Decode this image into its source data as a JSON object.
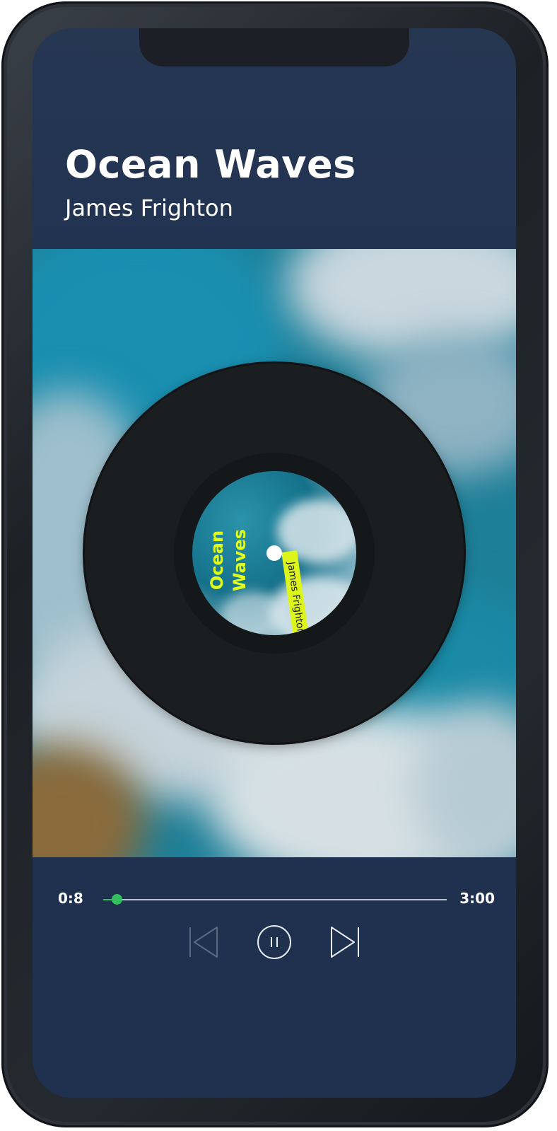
{
  "track": {
    "title": "Ocean Waves",
    "artist": "James Frighton"
  },
  "record_label": {
    "title_line1": "Ocean",
    "title_line2": "Waves",
    "artist": "James Frighton"
  },
  "player": {
    "current_time": "0:8",
    "total_time": "3:00",
    "progress": 0.04,
    "state": "playing",
    "controls": [
      "previous-icon",
      "pause-icon",
      "next-icon"
    ]
  },
  "colors": {
    "background": "#203150",
    "accent": "#35c060",
    "label_highlight": "#e0ff1e"
  }
}
